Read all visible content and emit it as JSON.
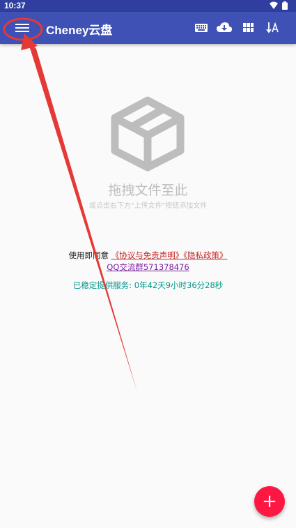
{
  "status_bar": {
    "time": "10:37"
  },
  "app_bar": {
    "title": "Cheney云盘",
    "actions": [
      "keyboard-icon",
      "cloud-download-icon",
      "grid-view-icon",
      "sort-icon"
    ]
  },
  "empty_state": {
    "icon": "box-icon",
    "title": "拖拽文件至此",
    "subtitle": "或点击右下方\"上传文件\"按钮添加文件"
  },
  "footer": {
    "agree_prefix": "使用即同意",
    "agreement_link": "《协议与免责声明》《隐私政策》",
    "qq_group": "QQ交流群571378476",
    "uptime": "已稳定提供服务: 0年42天9小时36分28秒"
  },
  "fab": {
    "label": "+"
  },
  "colors": {
    "app_bar": "#3f51b5",
    "status_bar": "#303f9f",
    "fab": "#ff1744",
    "annotation": "#e53935",
    "uptime_text": "#009688",
    "link_red": "#c62828",
    "link_purple": "#7b1fa2"
  }
}
